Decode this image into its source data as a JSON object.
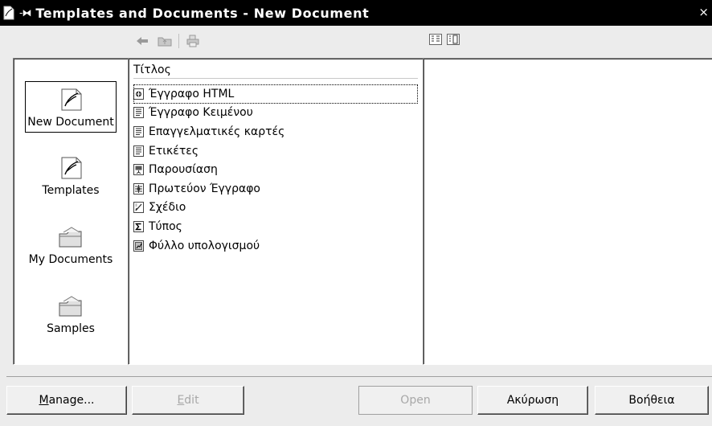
{
  "window": {
    "title": "Templates and Documents - New Document",
    "close_glyph": "×"
  },
  "categories": [
    {
      "id": "new-document",
      "label": "New Document",
      "icon": "new-document-icon",
      "selected": true
    },
    {
      "id": "templates",
      "label": "Templates",
      "icon": "templates-icon",
      "selected": false
    },
    {
      "id": "my-documents",
      "label": "My Documents",
      "icon": "folder-icon",
      "selected": false
    },
    {
      "id": "samples",
      "label": "Samples",
      "icon": "folder-icon",
      "selected": false
    }
  ],
  "list": {
    "column_header": "Τίτλος",
    "items": [
      {
        "label": "Έγγραφο HTML",
        "icon": "html-document-icon",
        "selected": true
      },
      {
        "label": "Έγγραφο Κειμένου",
        "icon": "text-document-icon",
        "selected": false
      },
      {
        "label": "Επαγγελματικές καρτές",
        "icon": "text-document-icon",
        "selected": false
      },
      {
        "label": "Ετικέτες",
        "icon": "text-document-icon",
        "selected": false
      },
      {
        "label": "Παρουσίαση",
        "icon": "presentation-icon",
        "selected": false
      },
      {
        "label": "Πρωτεύον Έγγραφο",
        "icon": "master-document-icon",
        "selected": false
      },
      {
        "label": "Σχέδιο",
        "icon": "drawing-icon",
        "selected": false
      },
      {
        "label": "Τύπος",
        "icon": "formula-icon",
        "selected": false
      },
      {
        "label": "Φύλλο υπολογισμού",
        "icon": "spreadsheet-icon",
        "selected": false
      }
    ]
  },
  "buttons": {
    "manage_first": "M",
    "manage_rest": "anage...",
    "edit_first": "E",
    "edit_rest": "dit",
    "open": "Open",
    "cancel": "Ακύρωση",
    "help": "Βοήθεια"
  }
}
